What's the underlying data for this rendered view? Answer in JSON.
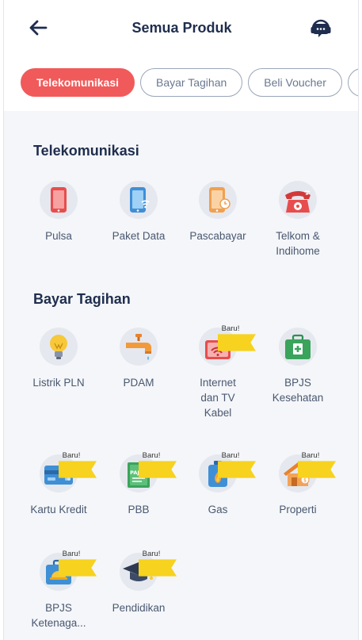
{
  "header": {
    "title": "Semua Produk",
    "back_icon": "arrow-left-icon",
    "help_icon": "headset-chat-icon"
  },
  "tabs": [
    {
      "label": "Telekomunikasi",
      "active": true
    },
    {
      "label": "Bayar Tagihan",
      "active": false
    },
    {
      "label": "Beli Voucher",
      "active": false
    },
    {
      "label": "",
      "active": false
    }
  ],
  "sections": [
    {
      "title": "Telekomunikasi",
      "items": [
        {
          "label": "Pulsa",
          "icon": "phone-icon"
        },
        {
          "label": "Paket Data",
          "icon": "phone-wifi-icon"
        },
        {
          "label": "Pascabayar",
          "icon": "phone-clock-icon"
        },
        {
          "label": "Telkom & Indihome",
          "icon": "telephone-icon"
        }
      ]
    },
    {
      "title": "Bayar Tagihan",
      "items": [
        {
          "label": "Listrik PLN",
          "icon": "lightbulb-icon"
        },
        {
          "label": "PDAM",
          "icon": "water-tap-icon"
        },
        {
          "label": "Internet dan TV Kabel",
          "icon": "router-icon",
          "badge": "Baru!"
        },
        {
          "label": "BPJS Kesehatan",
          "icon": "medical-bag-icon"
        },
        {
          "label": "Kartu Kredit",
          "icon": "credit-card-icon",
          "badge": "Baru!"
        },
        {
          "label": "PBB",
          "icon": "tax-document-icon",
          "badge": "Baru!",
          "icon_text": "PAJAK"
        },
        {
          "label": "Gas",
          "icon": "gas-canister-icon",
          "badge": "Baru!"
        },
        {
          "label": "Properti",
          "icon": "house-icon",
          "badge": "Baru!"
        },
        {
          "label": "BPJS Ketenaga...",
          "icon": "helmet-bag-icon",
          "badge": "Baru!"
        },
        {
          "label": "Pendidikan",
          "icon": "graduation-cap-icon",
          "badge": "Baru!"
        }
      ]
    }
  ]
}
